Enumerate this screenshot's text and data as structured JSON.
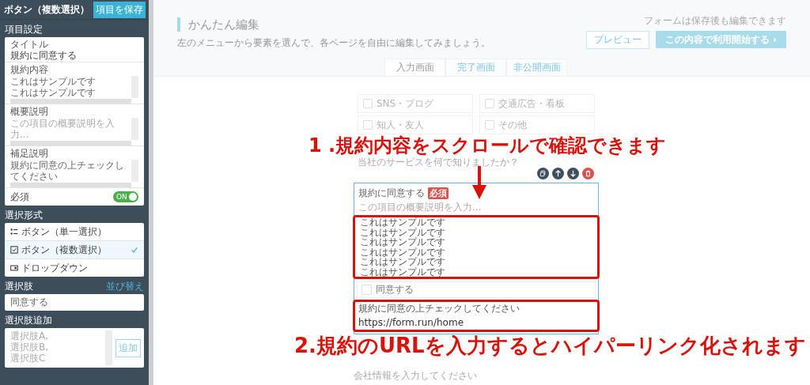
{
  "sidebar": {
    "title": "ボタン（複数選択）",
    "save_button": "項目を保存",
    "item_settings": {
      "label": "項目設定",
      "title_field": {
        "label": "タイトル",
        "value": "規約に同意する"
      },
      "terms_field": {
        "label": "規約内容",
        "lines": [
          "これはサンプルです",
          "これはサンプルです"
        ]
      },
      "summary_field": {
        "label": "概要説明",
        "placeholder": "この項目の概要説明を入力..."
      },
      "note_field": {
        "label": "補足説明",
        "lines": [
          "規約に同意の上チェックし",
          "てください"
        ]
      },
      "required": {
        "label": "必須",
        "on": true,
        "toggle_text": "ON"
      }
    },
    "format": {
      "label": "選択形式",
      "items": [
        {
          "kind": "radio",
          "label": "ボタン（単一選択）",
          "selected": false
        },
        {
          "kind": "checkbox",
          "label": "ボタン（複数選択）",
          "selected": true
        },
        {
          "kind": "dropdown",
          "label": "ドロップダウン",
          "selected": false
        }
      ]
    },
    "choices": {
      "label": "選択肢",
      "link": "並び替え",
      "value": "同意する"
    },
    "add_choices": {
      "label": "選択肢追加",
      "placeholder_lines": [
        "選択肢A,",
        "選択肢B,",
        "選択肢C"
      ],
      "button": "追加"
    }
  },
  "header": {
    "title": "かんたん編集",
    "subtitle": "左のメニューから要素を選んで、各ページを自由に編集してみましょう。",
    "note": "フォームは保存後も編集できます",
    "preview_button": "プレビュー",
    "start_button": "この内容で利用開始する ›"
  },
  "tabs": [
    {
      "label": "入力画面",
      "selected": true
    },
    {
      "label": "完了画面",
      "selected": false
    },
    {
      "label": "非公開画面",
      "selected": false
    }
  ],
  "form": {
    "option_rows": [
      [
        {
          "label": "SNS・ブログ",
          "checked": false
        },
        {
          "label": "交通広告・看板",
          "checked": false
        }
      ],
      [
        {
          "label": "知人・友人",
          "checked": false
        },
        {
          "label": "その他",
          "checked": false
        }
      ]
    ],
    "question": "当社のサービスを何で知りましたか？",
    "card": {
      "title": "規約に同意する",
      "badge": "必須",
      "description_placeholder": "この項目の概要説明を入力...",
      "terms_lines": [
        "これはサンプルです",
        "これはサンプルです",
        "これはサンプルです",
        "これはサンプルです",
        "これはサンプルです",
        "これはサンプルです"
      ],
      "option": {
        "label": "同意する",
        "checked": false
      },
      "note": "規約に同意の上チェックしてください",
      "url": "https://form.run/home"
    },
    "next_placeholder": "会社情報を入力してください"
  },
  "annotations": [
    "1 .規約内容をスクロールで確認できます",
    "2.規約のURLを入力するとハイパーリンク化されます"
  ]
}
